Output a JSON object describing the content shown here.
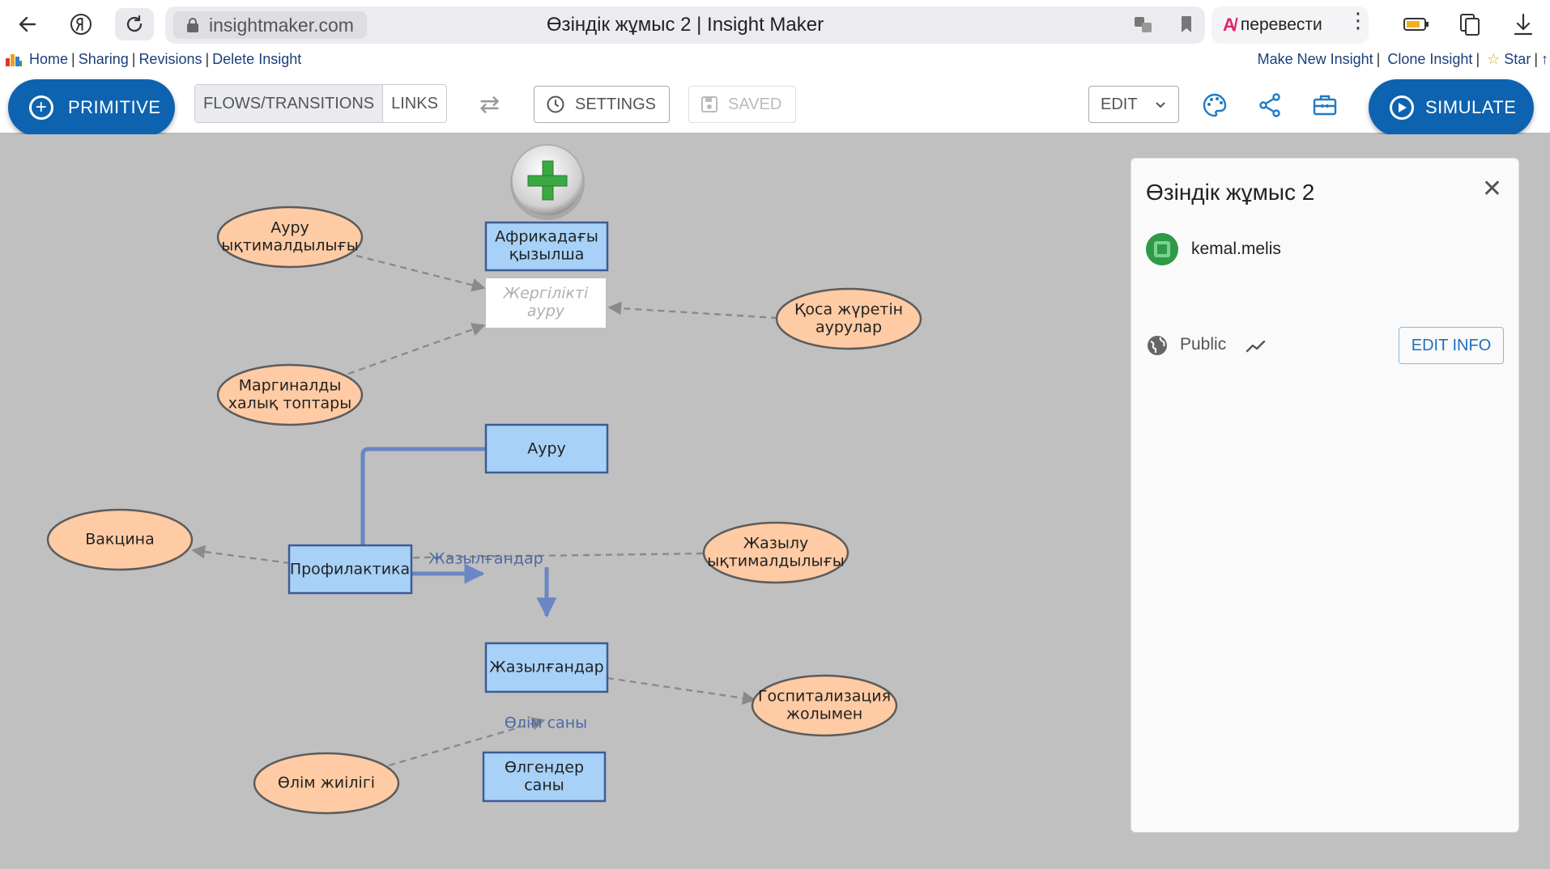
{
  "browser": {
    "url": "insightmaker.com",
    "tab_title": "Өзіндік жұмыс 2 | Insight Maker",
    "translate_label": "перевести"
  },
  "insight_links": {
    "left": [
      "Home",
      "Sharing",
      "Revisions",
      "Delete Insight"
    ],
    "right": [
      "Make New Insight",
      "Clone Insight",
      "Star"
    ],
    "star_glyph": "☆",
    "tail": "↑"
  },
  "toolbar": {
    "primitive_label": "PRIMITIVE",
    "flows_label": "FLOWS/TRANSITIONS",
    "links_label": "LINKS",
    "settings_label": "SETTINGS",
    "saved_label": "SAVED",
    "edit_label": "EDIT",
    "simulate_label": "SIMULATE",
    "accent_color": "#0d63b0"
  },
  "diagram": {
    "stocks": [
      {
        "id": "africa",
        "lines": [
          "Африкадағы",
          "қызылша"
        ]
      },
      {
        "id": "aury",
        "lines": [
          "Ауру"
        ]
      },
      {
        "id": "profil",
        "lines": [
          "Профилактика"
        ]
      },
      {
        "id": "zhaz",
        "lines": [
          "Жазылғандар"
        ]
      },
      {
        "id": "olg",
        "lines": [
          "Өлгендер",
          "саны"
        ]
      }
    ],
    "variable": {
      "id": "zherg",
      "lines": [
        "Жергілікті",
        "ауру"
      ]
    },
    "parameters": [
      {
        "id": "p1",
        "lines": [
          "Ауру",
          "ықтималдылығы"
        ]
      },
      {
        "id": "p2",
        "lines": [
          "Маргиналды",
          "халық топтары"
        ]
      },
      {
        "id": "p3",
        "lines": [
          "Қоса жүретін",
          "аурулар"
        ]
      },
      {
        "id": "p4",
        "lines": [
          "Вакцина"
        ]
      },
      {
        "id": "p5",
        "lines": [
          "Жазылу",
          "ықтималдылығы"
        ]
      },
      {
        "id": "p6",
        "lines": [
          "Госпитализация",
          "жолымен"
        ]
      },
      {
        "id": "p7",
        "lines": [
          "Өлім жиілігі"
        ]
      }
    ],
    "flow_labels": [
      "Жазылғандар",
      "Өлім саны"
    ],
    "colors": {
      "stock_fill": "#a7d1f7",
      "param_fill": "#ffcba4",
      "flow": "#6b86c4",
      "link": "#8a8a8a"
    }
  },
  "panel": {
    "title": "Өзіндік жұмыс 2",
    "author": "kemal.melis",
    "visibility": "Public",
    "edit_info_label": "EDIT INFO",
    "close_glyph": "✕"
  }
}
